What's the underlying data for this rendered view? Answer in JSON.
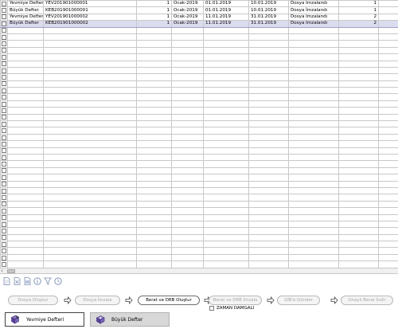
{
  "grid": {
    "rows": [
      {
        "defter": "Yevmiye Defteri",
        "belge_no": "YEV201901000001",
        "parca": "1",
        "donem": "Ocak-2019",
        "baslangic": "01.01.2019",
        "bitis": "10.01.2019",
        "durum": "Dosya İmzalandı",
        "sira": "1"
      },
      {
        "defter": "Büyük Defter",
        "belge_no": "KEB201901000001",
        "parca": "1",
        "donem": "Ocak-2019",
        "baslangic": "01.01.2019",
        "bitis": "10.01.2019",
        "durum": "Dosya İmzalandı",
        "sira": "1"
      },
      {
        "defter": "Yevmiye Defteri",
        "belge_no": "YEV201901000002",
        "parca": "1",
        "donem": "Ocak-2019",
        "baslangic": "11.01.2019",
        "bitis": "31.01.2019",
        "durum": "Dosya İmzalandı",
        "sira": "2"
      },
      {
        "defter": "Büyük Defter",
        "belge_no": "KEB201901000002",
        "parca": "1",
        "donem": "Ocak-2019",
        "baslangic": "11.01.2019",
        "bitis": "31.01.2019",
        "durum": "Dosya İmzalandı",
        "sira": "2"
      }
    ],
    "selected_row": 3
  },
  "toolbar_icons": [
    "new-document-icon",
    "delete-icon",
    "document-icon",
    "info-icon",
    "filter-icon",
    "refresh-icon"
  ],
  "workflow": {
    "steps": [
      "Dosya Oluştur",
      "Dosya İmzala",
      "Berat ve DRB Oluştur",
      "Berat ve DRB İmzala",
      "GİB'e Gönder",
      "Onaylı Berat İndir"
    ],
    "active_step": 2
  },
  "zaman_damgali": {
    "label": "ZAMAN DAMGALI",
    "checked": false
  },
  "tabs": [
    {
      "label": "Yevmiye Defteri",
      "icon": "book-ledger-icon",
      "active": true
    },
    {
      "label": "Büyük Defter",
      "icon": "book-icon",
      "active": false
    }
  ],
  "colors": {
    "selected_row": "#dcdcef",
    "accent": "#6f4fa6"
  }
}
